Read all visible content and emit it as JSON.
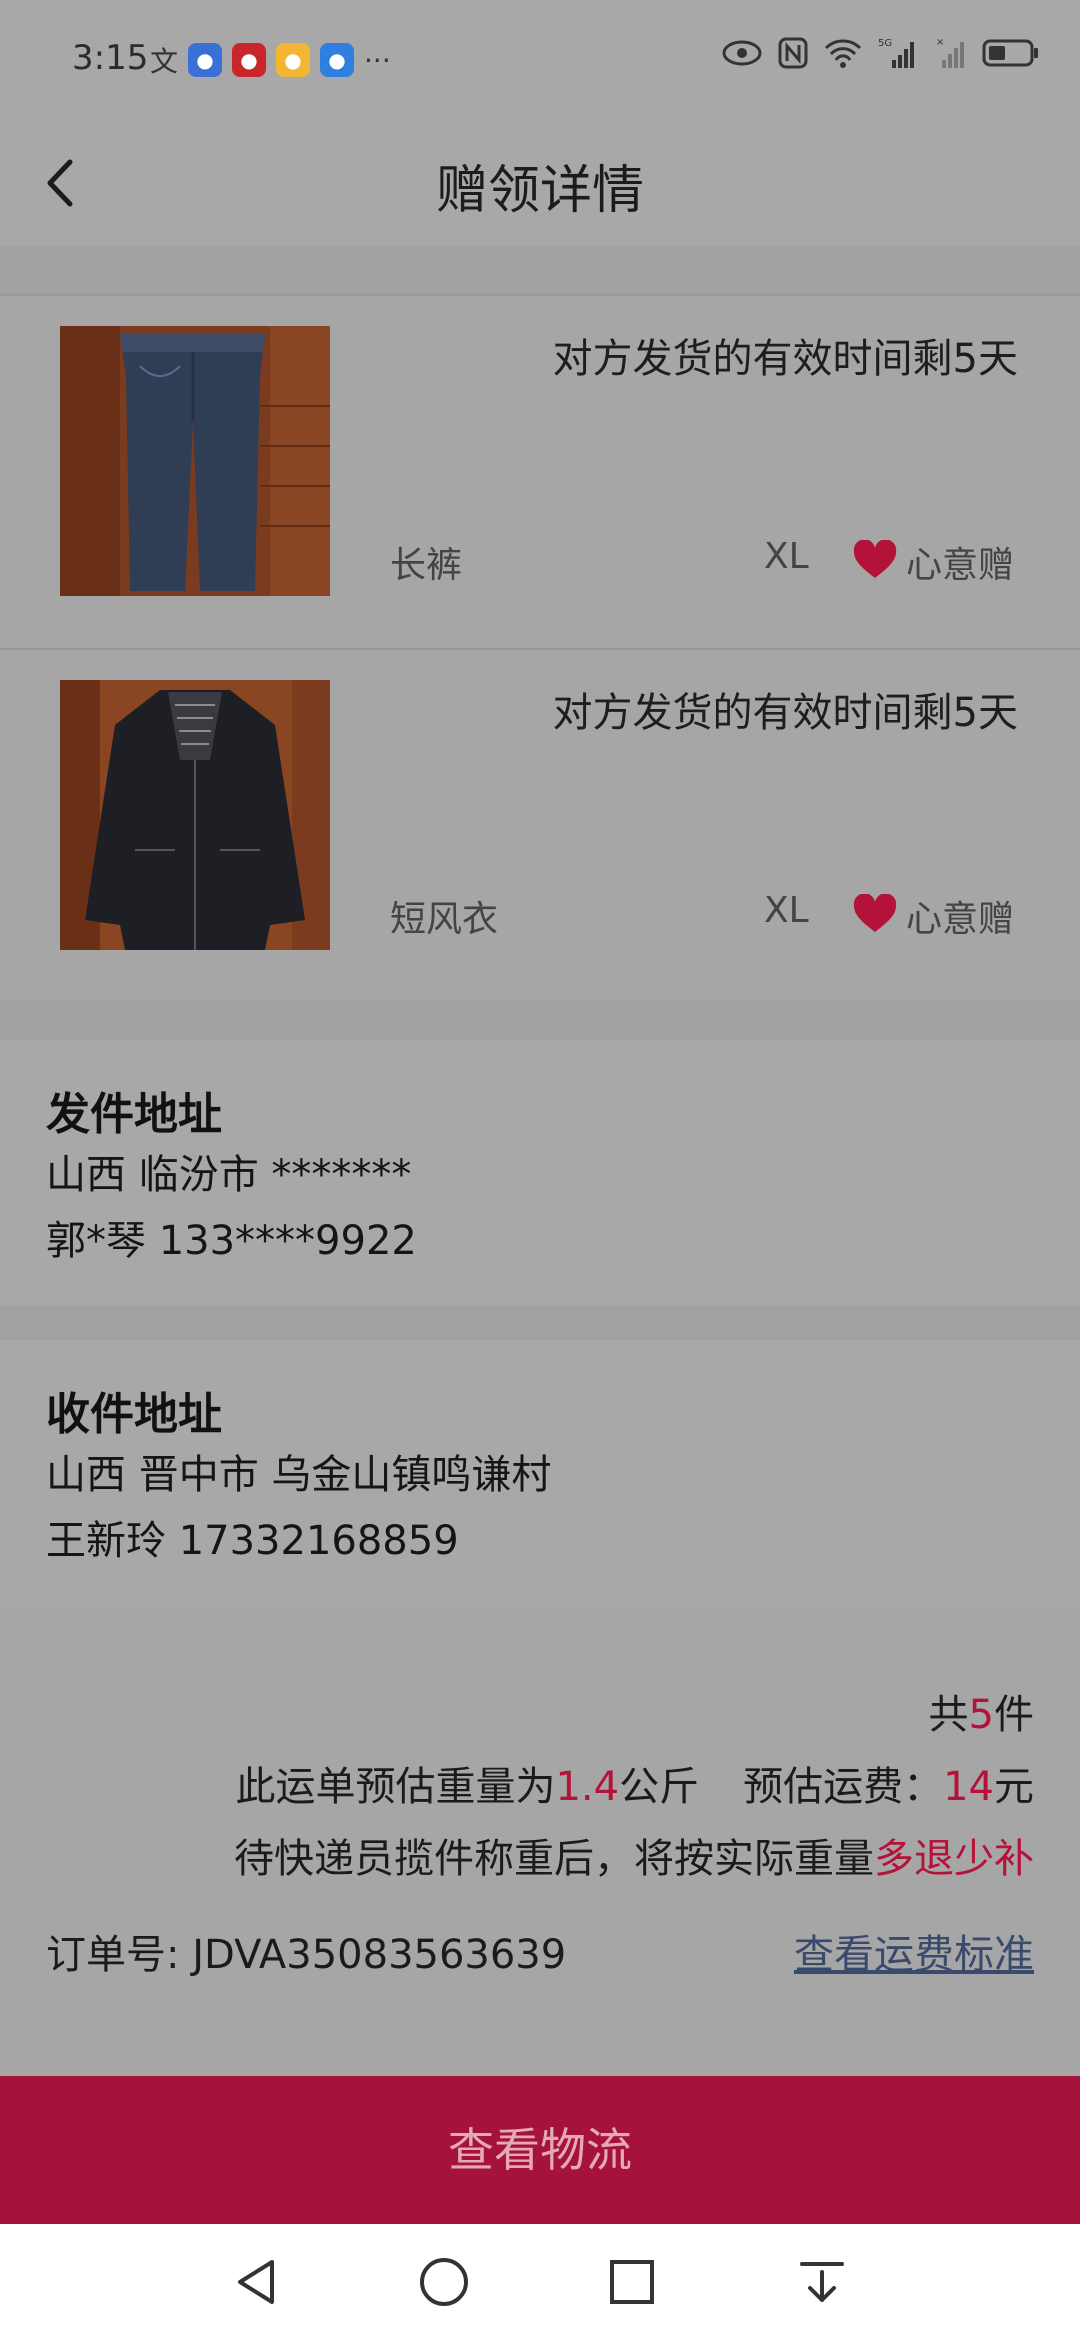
{
  "status": {
    "time": "3:15"
  },
  "header": {
    "title": "赠领详情"
  },
  "items": [
    {
      "remaining": "对方发货的有效时间剩5天",
      "name": "长裤",
      "size": "XL",
      "type": "心意赠"
    },
    {
      "remaining": "对方发货的有效时间剩5天",
      "name": "短风衣",
      "size": "XL",
      "type": "心意赠"
    }
  ],
  "sender": {
    "heading": "发件地址",
    "address": "山西 临汾市 *******",
    "contact": "郭*琴 133****9922"
  },
  "receiver": {
    "heading": "收件地址",
    "address": "山西 晋中市 乌金山镇鸣谦村",
    "contact": "王新玲 17332168859"
  },
  "summary": {
    "count_prefix": "共",
    "count": "5",
    "count_suffix": "件",
    "weight_prefix": "此运单预估重量为",
    "weight": "1.4",
    "weight_unit": "公斤",
    "fee_label": "预估运费：",
    "fee": "14",
    "fee_unit": "元",
    "note_prefix": "待快递员揽件称重后，将按实际重量",
    "note_highlight": "多退少补",
    "order_label": "订单号:",
    "order_no": "JDVA35083563639",
    "fee_standard_link": "查看运费标准"
  },
  "footer": {
    "button": "查看物流"
  },
  "colors": {
    "accent": "#a5123a",
    "highlight": "#b5123a",
    "link": "#3a4a6c"
  },
  "icons": [
    "back-arrow-icon",
    "heart-icon",
    "nav-back-icon",
    "nav-home-icon",
    "nav-recents-icon",
    "nav-download-icon"
  ]
}
